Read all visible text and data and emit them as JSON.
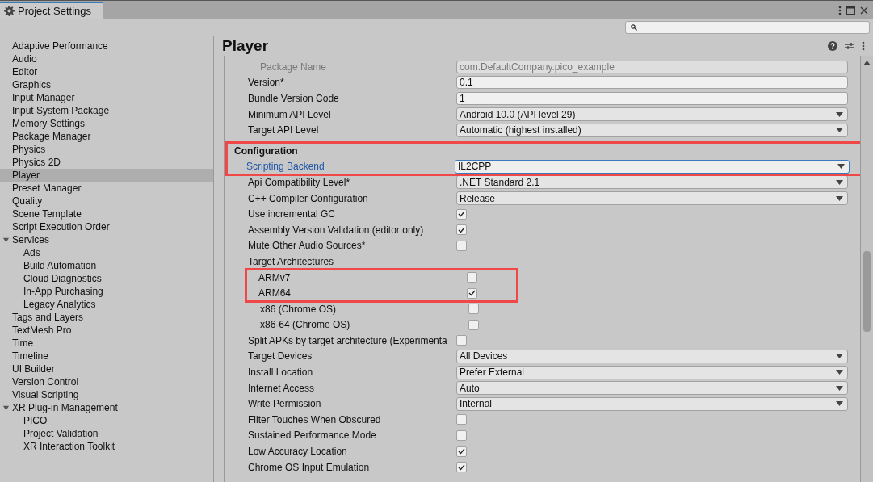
{
  "window": {
    "title": "Project Settings"
  },
  "sidebar": {
    "items": [
      {
        "label": "Adaptive Performance",
        "selected": false
      },
      {
        "label": "Audio",
        "selected": false
      },
      {
        "label": "Editor",
        "selected": false
      },
      {
        "label": "Graphics",
        "selected": false
      },
      {
        "label": "Input Manager",
        "selected": false
      },
      {
        "label": "Input System Package",
        "selected": false
      },
      {
        "label": "Memory Settings",
        "selected": false
      },
      {
        "label": "Package Manager",
        "selected": false
      },
      {
        "label": "Physics",
        "selected": false
      },
      {
        "label": "Physics 2D",
        "selected": false
      },
      {
        "label": "Player",
        "selected": true
      },
      {
        "label": "Preset Manager",
        "selected": false
      },
      {
        "label": "Quality",
        "selected": false
      },
      {
        "label": "Scene Template",
        "selected": false
      },
      {
        "label": "Script Execution Order",
        "selected": false
      },
      {
        "label": "Services",
        "selected": false,
        "expanded": true,
        "children": [
          {
            "label": "Ads",
            "selected": false
          },
          {
            "label": "Build Automation",
            "selected": false
          },
          {
            "label": "Cloud Diagnostics",
            "selected": false
          },
          {
            "label": "In-App Purchasing",
            "selected": false
          },
          {
            "label": "Legacy Analytics",
            "selected": false
          }
        ]
      },
      {
        "label": "Tags and Layers",
        "selected": false
      },
      {
        "label": "TextMesh Pro",
        "selected": false
      },
      {
        "label": "Time",
        "selected": false
      },
      {
        "label": "Timeline",
        "selected": false
      },
      {
        "label": "UI Builder",
        "selected": false
      },
      {
        "label": "Version Control",
        "selected": false
      },
      {
        "label": "Visual Scripting",
        "selected": false
      },
      {
        "label": "XR Plug-in Management",
        "selected": false,
        "expanded": true,
        "children": [
          {
            "label": "PICO",
            "selected": false
          },
          {
            "label": "Project Validation",
            "selected": false
          },
          {
            "label": "XR Interaction Toolkit",
            "selected": false
          }
        ]
      }
    ]
  },
  "panel": {
    "title": "Player",
    "rows": [
      {
        "kind": "readonly",
        "label": "Package Name",
        "value": "com.DefaultCompany.pico_example",
        "highlighted": false,
        "focused": false
      },
      {
        "kind": "text",
        "label": "Version*",
        "value": "0.1",
        "highlighted": false,
        "focused": false
      },
      {
        "kind": "text",
        "label": "Bundle Version Code",
        "value": "1",
        "highlighted": false,
        "focused": false
      },
      {
        "kind": "dropdown",
        "label": "Minimum API Level",
        "value": "Android 10.0 (API level 29)",
        "highlighted": false,
        "focused": false
      },
      {
        "kind": "dropdown",
        "label": "Target API Level",
        "value": "Automatic (highest installed)",
        "highlighted": false,
        "focused": false
      },
      {
        "kind": "header",
        "label": "Configuration",
        "highlighted": true,
        "focused": false
      },
      {
        "kind": "dropdown",
        "label": "Scripting Backend",
        "value": "IL2CPP",
        "highlighted": true,
        "focused": true
      },
      {
        "kind": "dropdown",
        "label": "Api Compatibility Level*",
        "value": ".NET Standard 2.1",
        "highlighted": false,
        "focused": false
      },
      {
        "kind": "dropdown",
        "label": "C++ Compiler Configuration",
        "value": "Release",
        "highlighted": false,
        "focused": false
      },
      {
        "kind": "checkbox",
        "label": "Use incremental GC",
        "checked": true,
        "highlighted": false,
        "focused": false
      },
      {
        "kind": "checkbox",
        "label": "Assembly Version Validation (editor only)",
        "checked": true,
        "highlighted": false,
        "focused": false
      },
      {
        "kind": "checkbox",
        "label": "Mute Other Audio Sources*",
        "checked": false,
        "highlighted": false,
        "focused": false
      },
      {
        "kind": "label",
        "label": "Target Architectures",
        "highlighted": false,
        "focused": false,
        "children": [
          {
            "kind": "checkbox",
            "label": "ARMv7",
            "checked": false,
            "highlighted": true,
            "focused": false
          },
          {
            "kind": "checkbox",
            "label": "ARM64",
            "checked": true,
            "highlighted": true,
            "focused": false
          },
          {
            "kind": "checkbox",
            "label": "x86 (Chrome OS)",
            "checked": false,
            "highlighted": false,
            "focused": false
          },
          {
            "kind": "checkbox",
            "label": "x86-64 (Chrome OS)",
            "checked": false,
            "highlighted": false,
            "focused": false
          }
        ]
      },
      {
        "kind": "checkbox",
        "label": "Split APKs by target architecture (Experimenta",
        "checked": false,
        "highlighted": false,
        "focused": false
      },
      {
        "kind": "dropdown",
        "label": "Target Devices",
        "value": "All Devices",
        "highlighted": false,
        "focused": false
      },
      {
        "kind": "dropdown",
        "label": "Install Location",
        "value": "Prefer External",
        "highlighted": false,
        "focused": false
      },
      {
        "kind": "dropdown",
        "label": "Internet Access",
        "value": "Auto",
        "highlighted": false,
        "focused": false
      },
      {
        "kind": "dropdown",
        "label": "Write Permission",
        "value": "Internal",
        "highlighted": false,
        "focused": false
      },
      {
        "kind": "checkbox",
        "label": "Filter Touches When Obscured",
        "checked": false,
        "highlighted": false,
        "focused": false
      },
      {
        "kind": "checkbox",
        "label": "Sustained Performance Mode",
        "checked": false,
        "highlighted": false,
        "focused": false
      },
      {
        "kind": "checkbox",
        "label": "Low Accuracy Location",
        "checked": true,
        "highlighted": false,
        "focused": false
      },
      {
        "kind": "checkbox",
        "label": "Chrome OS Input Emulation",
        "checked": true,
        "highlighted": false,
        "focused": false
      }
    ]
  }
}
